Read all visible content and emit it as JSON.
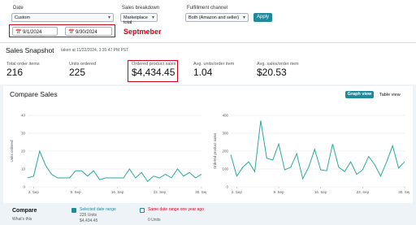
{
  "filters": {
    "date": {
      "label": "Date",
      "value": "Custom",
      "start": "9/1/2024",
      "end": "9/30/2024"
    },
    "sales_breakdown": {
      "label": "Sales breakdown",
      "value": "Marketplace total"
    },
    "fulfillment": {
      "label": "Fulfillment channel",
      "value": "Both (Amazon and seller)"
    },
    "apply_label": "Apply"
  },
  "annotation": "Septmeber",
  "snapshot": {
    "title": "Sales Snapshot",
    "taken": "taken at 11/22/2024, 3:35:47 PM PST",
    "metrics": [
      {
        "label": "Total order items",
        "value": "216"
      },
      {
        "label": "Units ordered",
        "value": "225"
      },
      {
        "label": "Ordered product sales",
        "value": "$4,434.45"
      },
      {
        "label": "Avg. units/order item",
        "value": "1.04"
      },
      {
        "label": "Avg. sales/order item",
        "value": "$20.53"
      }
    ]
  },
  "compare": {
    "title": "Compare Sales",
    "graph_view": "Graph view",
    "table_view": "Table view",
    "bottom": {
      "title": "Compare",
      "subtitle": "What's this",
      "selected": {
        "label": "Selected date range",
        "units": "225 Units",
        "sales": "$4,434.45"
      },
      "last_year": {
        "label": "Same date range one year ago",
        "units": "0 Units"
      }
    }
  },
  "colors": {
    "accent": "#1f8a9b",
    "line": "#2aa89a",
    "annotation": "#d0021b"
  },
  "chart_data": [
    {
      "type": "line",
      "ylabel": "Units ordered",
      "x": [
        "1. Sep",
        "2",
        "3",
        "4",
        "5",
        "6",
        "7",
        "8",
        "9. Sep",
        "10",
        "11",
        "12",
        "13",
        "14",
        "15",
        "16. Sep",
        "17",
        "18",
        "19",
        "20",
        "21",
        "22",
        "23. Sep",
        "24",
        "25",
        "26",
        "27",
        "28",
        "29",
        "30. Sep"
      ],
      "xticks": [
        "2. Sep",
        "9. Sep",
        "16. Sep",
        "23. Sep",
        "30. Sep"
      ],
      "yticks": [
        "0",
        "10",
        "20",
        "30",
        "40"
      ],
      "ylim": [
        0,
        40
      ],
      "series": [
        {
          "values": [
            5,
            6,
            20,
            12,
            7,
            5,
            5,
            5,
            9,
            9,
            6,
            9,
            4,
            5,
            5,
            5,
            5,
            10,
            5,
            8,
            3,
            6,
            5,
            7,
            5,
            10,
            6,
            8,
            5,
            7
          ]
        }
      ]
    },
    {
      "type": "line",
      "ylabel": "Ordered product sales",
      "x": [
        "1. Sep",
        "2",
        "3",
        "4",
        "5",
        "6",
        "7",
        "8",
        "9. Sep",
        "10",
        "11",
        "12",
        "13",
        "14",
        "15",
        "16. Sep",
        "17",
        "18",
        "19",
        "20",
        "21",
        "22",
        "23. Sep",
        "24",
        "25",
        "26",
        "27",
        "28",
        "29",
        "30. Sep"
      ],
      "xticks": [
        "2. Sep",
        "9. Sep",
        "16. Sep",
        "23. Sep",
        "30. Sep"
      ],
      "yticks": [
        "0",
        "100",
        "200",
        "300",
        "400"
      ],
      "ylim": [
        0,
        400
      ],
      "series": [
        {
          "values": [
            180,
            60,
            110,
            140,
            85,
            370,
            160,
            150,
            240,
            95,
            110,
            185,
            45,
            110,
            210,
            95,
            90,
            240,
            110,
            85,
            140,
            70,
            95,
            170,
            125,
            60,
            140,
            230,
            105,
            140
          ]
        }
      ]
    }
  ]
}
